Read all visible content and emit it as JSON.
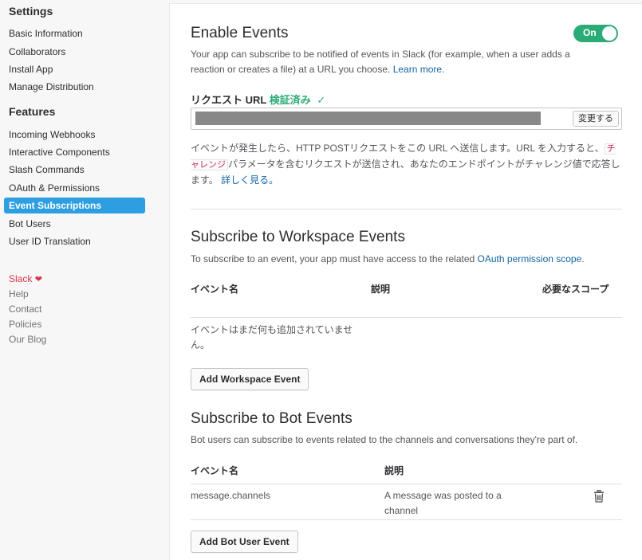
{
  "sidebar": {
    "settings_heading": "Settings",
    "settings_items": [
      {
        "label": "Basic Information"
      },
      {
        "label": "Collaborators"
      },
      {
        "label": "Install App"
      },
      {
        "label": "Manage Distribution"
      }
    ],
    "features_heading": "Features",
    "features_items": [
      {
        "label": "Incoming Webhooks"
      },
      {
        "label": "Interactive Components"
      },
      {
        "label": "Slash Commands"
      },
      {
        "label": "OAuth & Permissions"
      },
      {
        "label": "Event Subscriptions",
        "active": true
      },
      {
        "label": "Bot Users"
      },
      {
        "label": "User ID Translation"
      }
    ],
    "footer_links": [
      {
        "label": "Slack"
      },
      {
        "label": "Help"
      },
      {
        "label": "Contact"
      },
      {
        "label": "Policies"
      },
      {
        "label": "Our Blog"
      }
    ]
  },
  "enable_events": {
    "title": "Enable Events",
    "toggle_label": "On",
    "toggle_on": true,
    "description": "Your app can subscribe to be notified of events in Slack (for example, when a user adds a reaction or creates a file) at a URL you choose.",
    "learn_more": "Learn more."
  },
  "request_url": {
    "label": "リクエスト URL",
    "status": "検証済み",
    "change_button": "変更する",
    "help_part1": "イベントが発生したら、HTTP POSTリクエストをこの URL へ送信します。URL を入力すると、",
    "help_code": "チャレンジ",
    "help_part2": "パラメータを含むリクエストが送信され、あなたのエンドポイントがチャレンジ値で応答します。",
    "help_link": "詳しく見る。"
  },
  "workspace_events": {
    "title": "Subscribe to Workspace Events",
    "description": "To subscribe to an event, your app must have access to the related",
    "description_link": "OAuth permission scope",
    "description_end": ".",
    "columns": [
      "イベント名",
      "説明",
      "必要なスコープ"
    ],
    "empty_message": "イベントはまだ何も追加されていません。",
    "add_button": "Add Workspace Event"
  },
  "bot_events": {
    "title": "Subscribe to Bot Events",
    "description": "Bot users can subscribe to events related to the channels and conversations they're part of.",
    "columns": [
      "イベント名",
      "説明"
    ],
    "rows": [
      {
        "event": "message.channels",
        "description": "A message was posted to a channel"
      }
    ],
    "add_button": "Add Bot User Event"
  },
  "colors": {
    "accent": "#2d9ee0",
    "toggle_on": "#2bac76",
    "link": "#1264a3",
    "slack_red": "#d6344b"
  },
  "icons": [
    "check-icon",
    "heart-icon",
    "trash-icon"
  ]
}
